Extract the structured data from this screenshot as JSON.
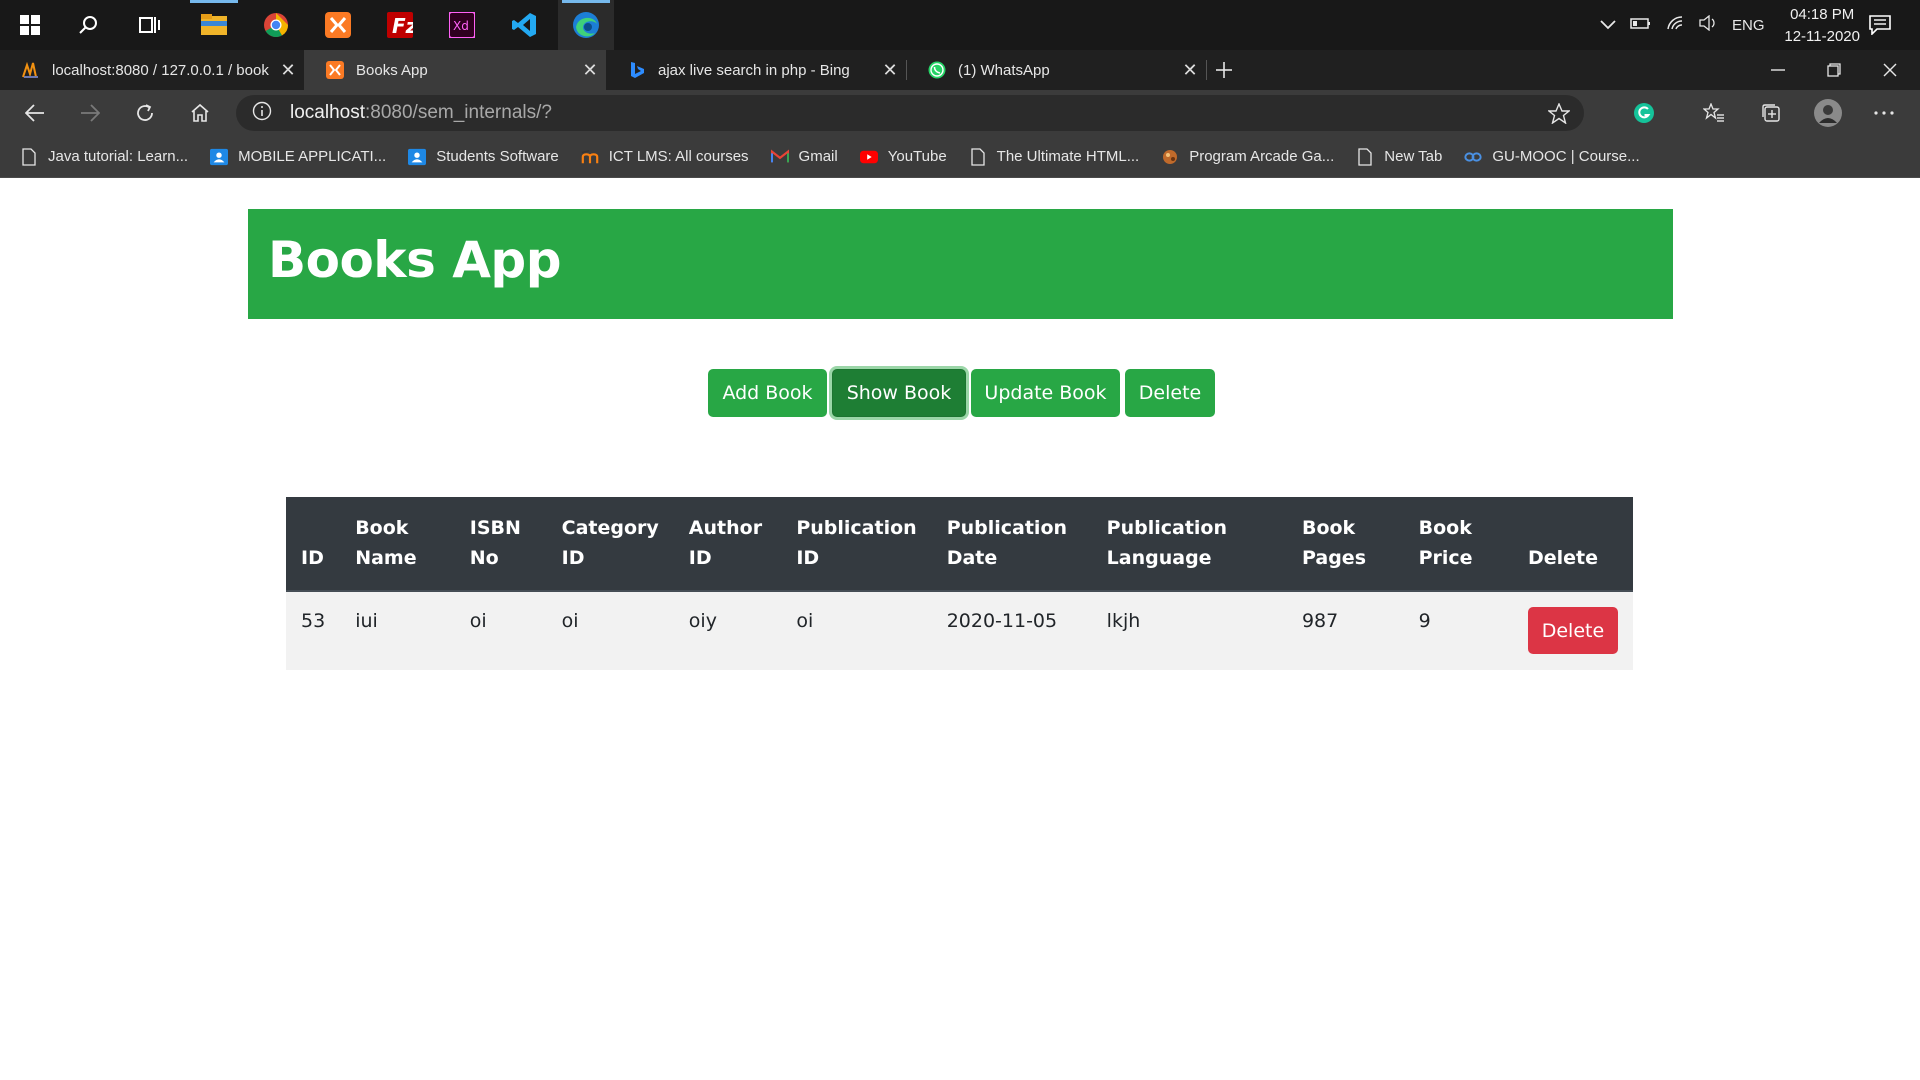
{
  "taskbar": {
    "apps": [
      {
        "name": "windows-start-icon"
      },
      {
        "name": "search-icon"
      },
      {
        "name": "task-view-icon"
      },
      {
        "name": "file-explorer-icon"
      },
      {
        "name": "chrome-icon"
      },
      {
        "name": "xampp-icon"
      },
      {
        "name": "filezilla-icon"
      },
      {
        "name": "adobe-xd-icon"
      },
      {
        "name": "vscode-icon"
      },
      {
        "name": "edge-icon"
      }
    ],
    "xd_label": "Xd",
    "language": "ENG",
    "time": "04:18 PM",
    "date": "12-11-2020"
  },
  "browser": {
    "tabs": [
      {
        "title": "localhost:8080 / 127.0.0.1 / book",
        "icon": "phpmyadmin-icon"
      },
      {
        "title": "Books App",
        "icon": "xampp-icon"
      },
      {
        "title": "ajax live search in php - Bing",
        "icon": "bing-icon"
      },
      {
        "title": "(1) WhatsApp",
        "icon": "whatsapp-icon"
      }
    ],
    "url_host": "localhost",
    "url_path": ":8080/sem_internals/?",
    "bookmarks": [
      {
        "label": "Java tutorial: Learn...",
        "icon": "page-icon"
      },
      {
        "label": "MOBILE APPLICATI...",
        "icon": "classroom-icon"
      },
      {
        "label": "Students Software",
        "icon": "classroom-icon"
      },
      {
        "label": "ICT LMS: All courses",
        "icon": "moodle-icon"
      },
      {
        "label": "Gmail",
        "icon": "gmail-icon"
      },
      {
        "label": "YouTube",
        "icon": "youtube-icon"
      },
      {
        "label": "The Ultimate HTML...",
        "icon": "page-icon"
      },
      {
        "label": "Program Arcade Ga...",
        "icon": "arcade-icon"
      },
      {
        "label": "New Tab",
        "icon": "page-icon"
      },
      {
        "label": "GU-MOOC | Course...",
        "icon": "mooc-icon"
      }
    ],
    "colors": {
      "accent_green": "#28a745",
      "danger": "#dc3545",
      "table_head": "#343a40"
    }
  },
  "app": {
    "title": "Books App",
    "buttons": [
      "Add Book",
      "Show Book",
      "Update Book",
      "Delete"
    ],
    "active_button": "Show Book",
    "table": {
      "headers": [
        [
          "ID"
        ],
        [
          "Book",
          "Name"
        ],
        [
          "ISBN",
          "No"
        ],
        [
          "Category",
          "ID"
        ],
        [
          "Author",
          "ID"
        ],
        [
          "Publication",
          "ID"
        ],
        [
          "Publication",
          "Date"
        ],
        [
          "Publication",
          "Language"
        ],
        [
          "Book",
          "Pages"
        ],
        [
          "Book",
          "Price"
        ],
        [
          "Delete"
        ]
      ],
      "rows": [
        [
          "53",
          "iui",
          "oi",
          "oi",
          "oiy",
          "oi",
          "2020-11-05",
          "lkjh",
          "987",
          "9"
        ]
      ],
      "row_action_label": "Delete"
    }
  }
}
